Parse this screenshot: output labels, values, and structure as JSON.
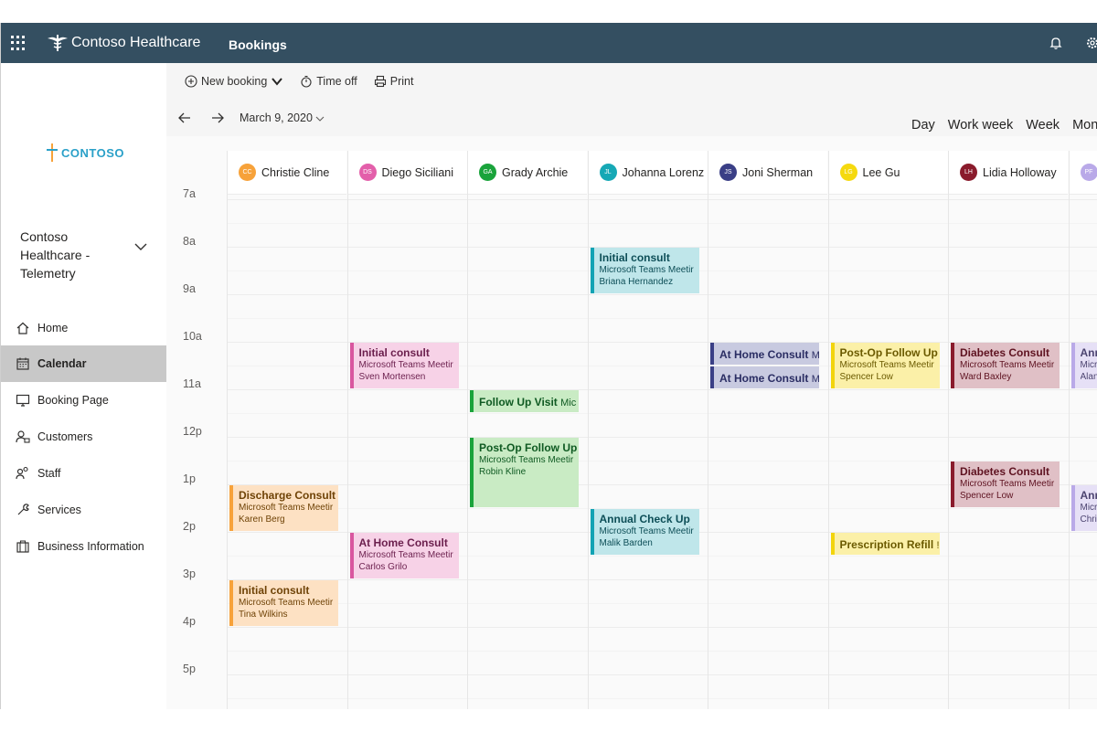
{
  "topbar": {
    "brand": "Contoso Healthcare",
    "app": "Bookings"
  },
  "sidebar": {
    "logo_text": "CONTOSO",
    "org_name": "Contoso Healthcare - Telemetry",
    "items": [
      {
        "label": "Home",
        "icon": "home-icon"
      },
      {
        "label": "Calendar",
        "icon": "calendar-icon"
      },
      {
        "label": "Booking Page",
        "icon": "monitor-icon"
      },
      {
        "label": "Customers",
        "icon": "customers-icon"
      },
      {
        "label": "Staff",
        "icon": "staff-icon"
      },
      {
        "label": "Services",
        "icon": "wrench-icon"
      },
      {
        "label": "Business Information",
        "icon": "briefcase-icon"
      }
    ]
  },
  "toolbar": {
    "new_booking": "New booking",
    "time_off": "Time off",
    "print": "Print"
  },
  "datebar": {
    "date": "March 9, 2020",
    "views": [
      "Day",
      "Work week",
      "Week",
      "Month"
    ]
  },
  "times": [
    "7a",
    "8a",
    "9a",
    "10a",
    "11a",
    "12p",
    "1p",
    "2p",
    "3p",
    "4p",
    "5p"
  ],
  "staff": [
    {
      "initials": "CC",
      "name": "Christie Cline",
      "color": "#f7a23a"
    },
    {
      "initials": "DS",
      "name": "Diego Siciliani",
      "color": "#e35faa"
    },
    {
      "initials": "GA",
      "name": "Grady Archie",
      "color": "#1aa33b"
    },
    {
      "initials": "JL",
      "name": "Johanna Lorenz",
      "color": "#16a8b5"
    },
    {
      "initials": "JS",
      "name": "Joni Sherman",
      "color": "#3a3f86"
    },
    {
      "initials": "LG",
      "name": "Lee Gu",
      "color": "#f5d90e"
    },
    {
      "initials": "LH",
      "name": "Lidia Holloway",
      "color": "#8a1b2c"
    },
    {
      "initials": "PF",
      "name": "",
      "color": "#b9a9e8"
    }
  ],
  "appointments": [
    {
      "col": 3,
      "start": 8.0,
      "title": "Initial consult",
      "sub": "Microsoft Teams Meetir",
      "person": "Briana Hernandez",
      "theme": "teal"
    },
    {
      "col": 1,
      "start": 10.0,
      "title": "Initial consult",
      "sub": "Microsoft Teams Meetir",
      "person": "Sven Mortensen",
      "theme": "pink"
    },
    {
      "col": 4,
      "start": 10.0,
      "title": "At Home Consult",
      "extra": "M",
      "theme": "navy",
      "short": true
    },
    {
      "col": 4,
      "start": 10.5,
      "title": "At Home Consult",
      "extra": "M",
      "theme": "navy",
      "short": true
    },
    {
      "col": 5,
      "start": 10.0,
      "title": "Post-Op Follow Up",
      "sub": "Microsoft Teams Meetir",
      "person": "Spencer Low",
      "theme": "yellow"
    },
    {
      "col": 6,
      "start": 10.0,
      "title": "Diabetes Consult",
      "sub": "Microsoft Teams Meetir",
      "person": "Ward Baxley",
      "theme": "maroon"
    },
    {
      "col": 7,
      "start": 10.0,
      "title": "Ann",
      "sub": "Micro",
      "person": "Alan",
      "theme": "lavender"
    },
    {
      "col": 2,
      "start": 11.0,
      "title": "Follow Up Visit",
      "extra": "Mic",
      "theme": "green",
      "short": true
    },
    {
      "col": 2,
      "start": 12.0,
      "end": 13.5,
      "title": "Post-Op Follow Up",
      "sub": "Microsoft Teams Meetir",
      "person": "Robin Kline",
      "theme": "green"
    },
    {
      "col": 6,
      "start": 12.5,
      "title": "Diabetes Consult",
      "sub": "Microsoft Teams Meetir",
      "person": "Spencer Low",
      "theme": "maroon"
    },
    {
      "col": 7,
      "start": 13.0,
      "title": "Ann",
      "sub": "Micro",
      "person": "Chris",
      "theme": "lavender"
    },
    {
      "col": 0,
      "start": 13.0,
      "title": "Discharge Consult",
      "sub": "Microsoft Teams Meetir",
      "person": "Karen Berg",
      "theme": "orange"
    },
    {
      "col": 3,
      "start": 13.5,
      "title": "Annual Check Up",
      "sub": "Microsoft Teams Meetir",
      "person": "Malik Barden",
      "theme": "teal"
    },
    {
      "col": 1,
      "start": 14.0,
      "title": "At Home Consult",
      "sub": "Microsoft Teams Meetir",
      "person": "Carlos Grilo",
      "theme": "pink"
    },
    {
      "col": 5,
      "start": 14.0,
      "title": "Prescription Refill",
      "extra": "!",
      "theme": "yellow",
      "short": true
    },
    {
      "col": 0,
      "start": 15.0,
      "title": "Initial consult",
      "sub": "Microsoft Teams Meetir",
      "person": "Tina Wilkins",
      "theme": "orange"
    }
  ],
  "themes": {
    "teal": {
      "bg": "#bfe6ea",
      "bar": "#12a3b4",
      "fg": "#0d4e57"
    },
    "pink": {
      "bg": "#f7d2e7",
      "bar": "#d9569f",
      "fg": "#6b1f4d"
    },
    "navy": {
      "bg": "#c8cae0",
      "bar": "#3a3f86",
      "fg": "#2a2d63"
    },
    "yellow": {
      "bg": "#fbf0a8",
      "bar": "#f2d40c",
      "fg": "#6b5a00"
    },
    "maroon": {
      "bg": "#e0c0c6",
      "bar": "#8a1b2c",
      "fg": "#5e1220"
    },
    "lavender": {
      "bg": "#e6e0f6",
      "bar": "#b9a9e8",
      "fg": "#4c4470"
    },
    "green": {
      "bg": "#c9ebc4",
      "bar": "#1aa33b",
      "fg": "#0f5a22"
    },
    "orange": {
      "bg": "#fde1c3",
      "bar": "#f7a23a",
      "fg": "#6f4307"
    }
  }
}
